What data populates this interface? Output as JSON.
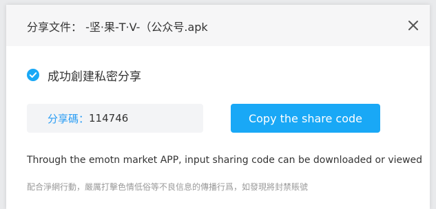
{
  "dialog": {
    "title": "分享文件：  -坚·果-T·V-（公众号.apk"
  },
  "status": {
    "text": "成功創建私密分享"
  },
  "share_code": {
    "label": "分享碼：",
    "value": "114746"
  },
  "copy_button": {
    "label": "Copy the share code"
  },
  "info": {
    "text": "Through the emotn market APP, input sharing code can be downloaded or viewed"
  },
  "notice": {
    "text": "配合淨網行動，嚴厲打擊色情低俗等不良信息的傳播行爲，如發現將封禁賬號"
  },
  "icons": {
    "close": "close-icon",
    "success": "check-circle-icon"
  },
  "colors": {
    "accent": "#19a8f6",
    "code_label": "#2a9df4",
    "header_bg": "#f6f6f7",
    "code_bg": "#f3f4f6",
    "notice": "#9a9a9a"
  }
}
